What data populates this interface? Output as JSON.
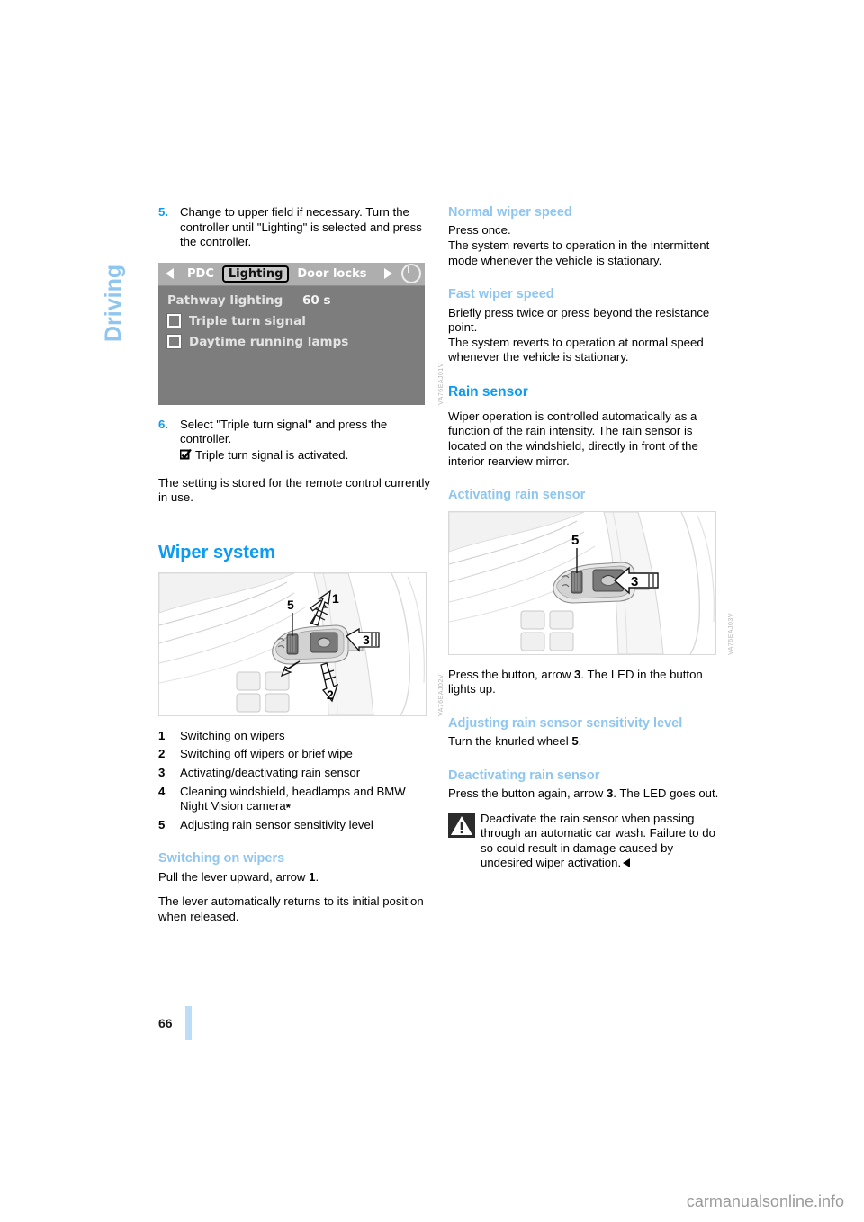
{
  "chapter": {
    "label": "Driving"
  },
  "footer": {
    "page_number": "66",
    "watermark": "carmanualsonline.info"
  },
  "left_column": {
    "step5": {
      "number": "5.",
      "text": "Change to upper field if necessary. Turn the controller until \"Lighting\" is selected and press the controller."
    },
    "idrive_screen": {
      "name": "idrive-lighting-menu",
      "arrow_left": "◀",
      "arrow_right": "▶",
      "tabs": [
        {
          "label": "PDC",
          "selected": false
        },
        {
          "label": "Lighting",
          "selected": true
        },
        {
          "label": "Door locks",
          "selected": false
        }
      ],
      "rows": [
        {
          "type": "value",
          "label": "Pathway lighting",
          "value": "60 s"
        },
        {
          "type": "checkbox",
          "label": "Triple turn signal",
          "checked": false
        },
        {
          "type": "checkbox",
          "label": "Daytime running lamps",
          "checked": false
        }
      ],
      "figure_id": "VA76EAJ01V"
    },
    "step6": {
      "number": "6.",
      "text": "Select \"Triple turn signal\" and press the controller.",
      "result": "Triple turn signal is activated."
    },
    "stored_note": "The setting is stored for the remote control currently in use.",
    "wiper_heading": "Wiper system",
    "wiper_figure": {
      "name": "wiper-stalk-illustration",
      "callouts": [
        "1",
        "2",
        "3",
        "5"
      ],
      "figure_id": "VA76EAJ02V"
    },
    "legend": [
      {
        "num": "1",
        "text": "Switching on wipers"
      },
      {
        "num": "2",
        "text": "Switching off wipers or brief wipe"
      },
      {
        "num": "3",
        "text": "Activating/deactivating rain sensor"
      },
      {
        "num": "4",
        "text": "Cleaning windshield, headlamps and BMW Night Vision camera",
        "star": "*"
      },
      {
        "num": "5",
        "text": "Adjusting rain sensor sensitivity level"
      }
    ],
    "switching_on": {
      "heading": "Switching on wipers",
      "para1_pre": "Pull the lever upward, arrow ",
      "para1_bold": "1",
      "para1_post": ".",
      "para2": "The lever automatically returns to its initial position when released."
    }
  },
  "right_column": {
    "normal_speed": {
      "heading": "Normal wiper speed",
      "para1": "Press once.",
      "para2": "The system reverts to operation in the intermittent mode whenever the vehicle is stationary."
    },
    "fast_speed": {
      "heading": "Fast wiper speed",
      "para1": "Briefly press twice or press beyond the resistance point.",
      "para2": "The system reverts to operation at normal speed whenever the vehicle is stationary."
    },
    "rain_sensor": {
      "heading": "Rain sensor",
      "para": "Wiper operation is controlled automatically as a function of the rain intensity. The rain sensor is located on the windshield, directly in front of the interior rearview mirror."
    },
    "activating": {
      "heading": "Activating rain sensor",
      "figure": {
        "name": "rain-sensor-button-illustration",
        "callouts": [
          "3",
          "5"
        ],
        "figure_id": "VA76EAJ03V"
      },
      "para_pre": "Press the button, arrow ",
      "para_bold": "3",
      "para_post": ". The LED in the button lights up."
    },
    "adjusting": {
      "heading": "Adjusting rain sensor sensitivity level",
      "para_pre": "Turn the knurled wheel ",
      "para_bold": "5",
      "para_post": "."
    },
    "deactivating": {
      "heading": "Deactivating rain sensor",
      "para_pre": "Press the button again, arrow ",
      "para_bold": "3",
      "para_post": ". The LED goes out.",
      "warning": "Deactivate the rain sensor when passing through an automatic car wash. Failure to do so could result in damage caused by undesired wiper activation."
    }
  },
  "colors": {
    "heading_primary": "#0c9bf2",
    "heading_secondary": "#8ec6f0",
    "folio_rule": "#bcdcf8"
  }
}
